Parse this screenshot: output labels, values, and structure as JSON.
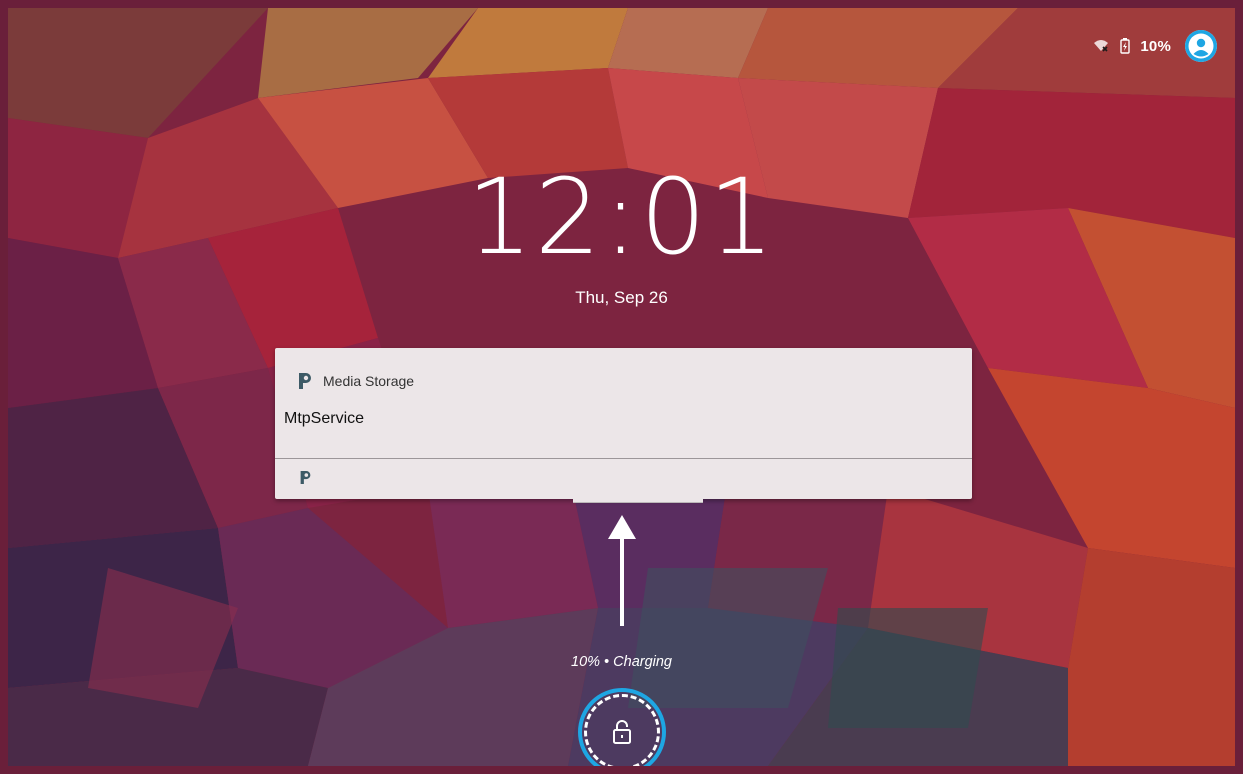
{
  "status_bar": {
    "wifi_icon": "wifi-off-icon",
    "battery_icon": "battery-charging-icon",
    "battery_text": "10%",
    "avatar_icon": "user-avatar-icon"
  },
  "lockscreen": {
    "time": "12:01",
    "date": "Thu, Sep 26",
    "charging_status": "10% • Charging"
  },
  "notification": {
    "app_icon": "p-app-icon",
    "app_name": "Media Storage",
    "title": "MtpService"
  },
  "lock_icon": "lock-open-icon",
  "colors": {
    "notification_bg": "#ece6e8",
    "lock_highlight": "#1ea6e3",
    "text": "#ffffff"
  }
}
